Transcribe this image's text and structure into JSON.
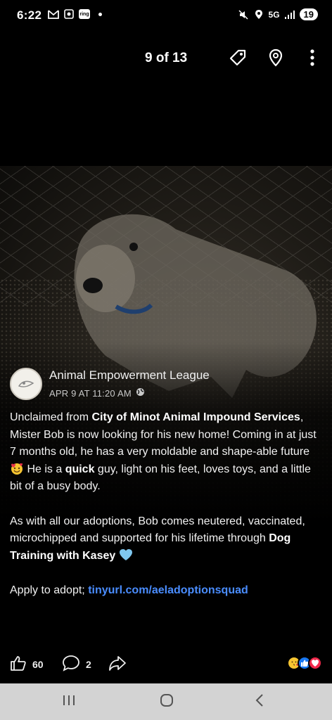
{
  "status": {
    "time": "6:22",
    "ring_label": "ring",
    "network": "5G",
    "battery": "19"
  },
  "header": {
    "counter": "9 of 13"
  },
  "post": {
    "page_name": "Animal Empowerment League",
    "timestamp": "APR 9 AT 11:20 AM",
    "p1": {
      "t1": "Unclaimed from ",
      "b1": "City of Minot Animal Impound Services",
      "t2": ", Mister Bob is now looking for his new home! Coming in at just 7 months old, he has a very moldable and shape-able future ",
      "t3": " He is a ",
      "b2": "quick",
      "t4": " guy, light on his feet, loves toys, and a little bit of a busy body."
    },
    "p2": {
      "t1": "As with all our adoptions, Bob comes neutered, vaccinated, microchipped and supported for his lifetime through ",
      "b1": "Dog Training with Kasey"
    },
    "p3": {
      "t1": "Apply to adopt; ",
      "link": "tinyurl.com/aeladoptionsquad"
    }
  },
  "actions": {
    "likes": "60",
    "comments": "2"
  },
  "icons": {
    "tag": "tag-icon",
    "location": "location-pin-icon",
    "more": "more-vertical-icon",
    "like": "thumbs-up-icon",
    "comment": "comment-icon",
    "share": "share-icon",
    "globe": "globe-icon"
  },
  "colors": {
    "link": "#4a8dff",
    "like_reaction": "#1877f2",
    "love_reaction": "#f0284a"
  }
}
